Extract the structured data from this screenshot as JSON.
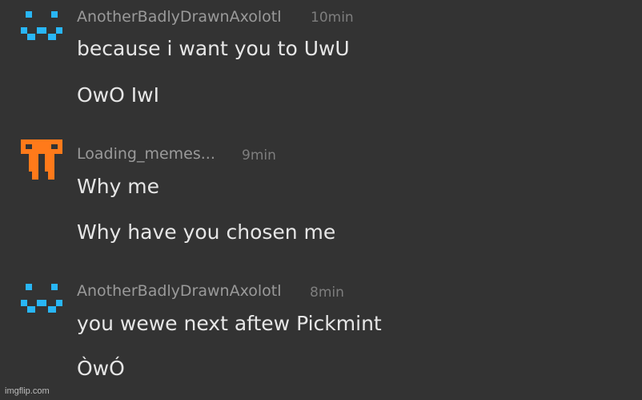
{
  "colors": {
    "background": "#333333",
    "username": "#9a9a9a",
    "timestamp": "#7e7e7e",
    "message_text": "#e6e6e6",
    "axolotl_avatar": "#29b6f6",
    "memes_avatar": "#ff7a1a"
  },
  "messages": [
    {
      "username": "AnotherBadlyDrawnAxolotl",
      "time": "10min",
      "avatar_icon": "pixel-face-icon",
      "lines": [
        "because i want you to UwU",
        "OwO IwI"
      ]
    },
    {
      "username": "Loading_memes...",
      "time": "9min",
      "avatar_icon": "pixel-creature-icon",
      "lines": [
        "Why me",
        "Why have you chosen me"
      ]
    },
    {
      "username": "AnotherBadlyDrawnAxolotl",
      "time": "8min",
      "avatar_icon": "pixel-face-icon",
      "lines": [
        "you wewe next aftew Pickmint",
        "ÒwÓ"
      ]
    }
  ],
  "watermark": "imgflip.com"
}
